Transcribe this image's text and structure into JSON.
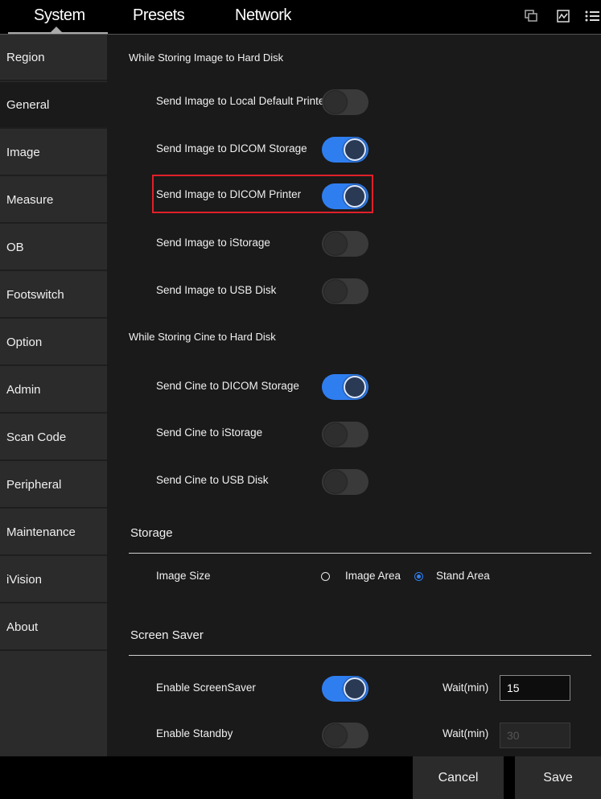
{
  "tabs": {
    "system": "System",
    "presets": "Presets",
    "network": "Network"
  },
  "top_icons": [
    "copy-icon",
    "waveform-icon",
    "menu-icon"
  ],
  "sidebar": {
    "items": [
      {
        "label": "Region"
      },
      {
        "label": "General",
        "active": true
      },
      {
        "label": "Image"
      },
      {
        "label": "Measure"
      },
      {
        "label": "OB"
      },
      {
        "label": "Footswitch"
      },
      {
        "label": "Option"
      },
      {
        "label": "Admin"
      },
      {
        "label": "Scan Code"
      },
      {
        "label": "Peripheral"
      },
      {
        "label": "Maintenance"
      },
      {
        "label": "iVision"
      },
      {
        "label": "About"
      }
    ]
  },
  "image_store": {
    "title": "While Storing Image to Hard Disk",
    "rows": [
      {
        "label": "Send Image to Local Default Printer",
        "on": false
      },
      {
        "label": "Send Image to DICOM Storage",
        "on": true
      },
      {
        "label": "Send Image to DICOM Printer",
        "on": true,
        "highlighted": true
      },
      {
        "label": "Send Image to iStorage",
        "on": false
      },
      {
        "label": "Send Image to USB Disk",
        "on": false
      }
    ]
  },
  "cine_store": {
    "title": "While Storing Cine to Hard Disk",
    "rows": [
      {
        "label": "Send Cine to DICOM Storage",
        "on": true
      },
      {
        "label": "Send Cine to iStorage",
        "on": false
      },
      {
        "label": "Send Cine to USB Disk",
        "on": false
      }
    ]
  },
  "storage": {
    "title": "Storage",
    "image_size_label": "Image Size",
    "options": [
      {
        "label": "Image Area",
        "checked": false
      },
      {
        "label": "Stand Area",
        "checked": true
      }
    ]
  },
  "screen_saver": {
    "title": "Screen Saver",
    "rows": [
      {
        "label": "Enable ScreenSaver",
        "on": true,
        "wait_label": "Wait(min)",
        "wait_value": "15",
        "disabled": false
      },
      {
        "label": "Enable Standby",
        "on": false,
        "wait_label": "Wait(min)",
        "wait_value": "30",
        "disabled": true
      }
    ]
  },
  "footer": {
    "cancel": "Cancel",
    "save": "Save"
  },
  "colors": {
    "accent": "#2f7ef0",
    "highlight": "#e0202a"
  }
}
